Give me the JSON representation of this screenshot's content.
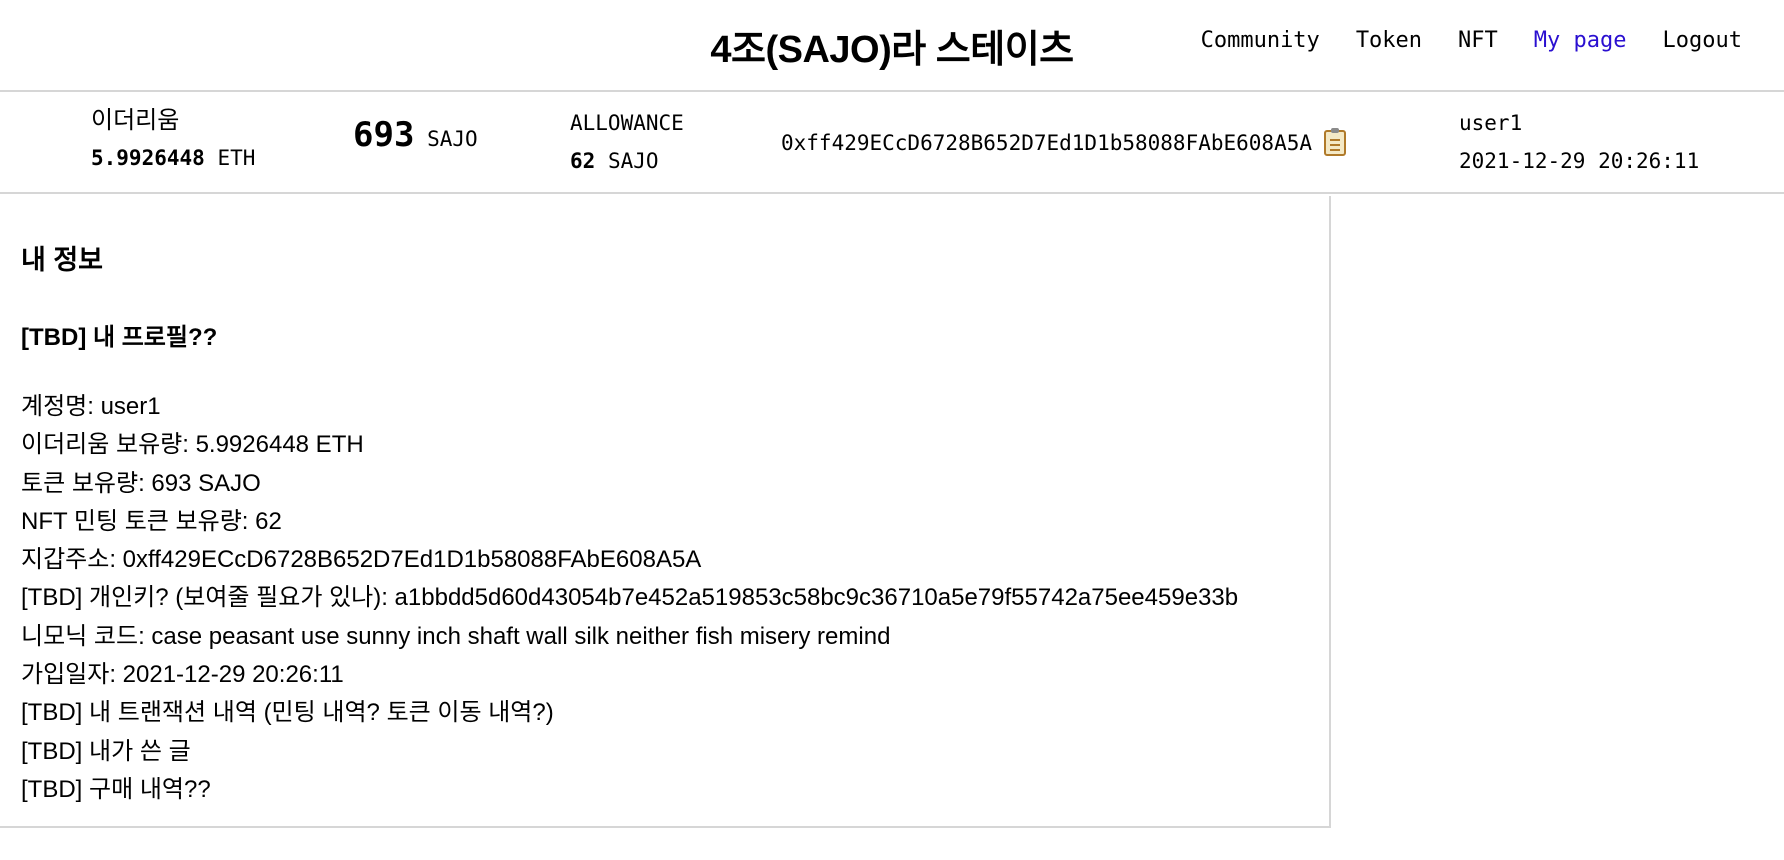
{
  "header": {
    "title": "4조(SAJO)라 스테이츠",
    "nav": [
      "Community",
      "Token",
      "NFT",
      "My page",
      "Logout"
    ],
    "active_nav": "My page",
    "active_color": "#2a0fd0"
  },
  "status": {
    "eth_label": "이더리움",
    "eth_value": "5.9926448",
    "eth_unit": "ETH",
    "token_value": "693",
    "token_unit": "SAJO",
    "allowance_label": "ALLOWANCE",
    "allowance_value": "62",
    "allowance_unit": "SAJO",
    "address": "0xff429ECcD6728B652D7Ed1D1b58088FAbE608A5A",
    "copy_icon": "clipboard-icon",
    "username": "user1",
    "timestamp": "2021-12-29 20:26:11"
  },
  "main": {
    "heading": "내 정보",
    "subheading": "[TBD] 내 프로필??",
    "lines": [
      "계정명: user1",
      "이더리움 보유량: 5.9926448 ETH",
      "토큰 보유량: 693 SAJO",
      "NFT 민팅 토큰 보유량: 62",
      "지갑주소: 0xff429ECcD6728B652D7Ed1D1b58088FAbE608A5A",
      "[TBD] 개인키? (보여줄 필요가 있나): a1bbdd5d60d43054b7e452a519853c58bc9c36710a5e79f55742a75ee459e33b",
      "니모닉 코드: case peasant use sunny inch shaft wall silk neither fish misery remind",
      "가입일자: 2021-12-29 20:26:11",
      "[TBD] 내 트랜잭션 내역 (민팅 내역? 토큰 이동 내역?)",
      "[TBD] 내가 쓴 글",
      "[TBD] 구매 내역??"
    ]
  }
}
